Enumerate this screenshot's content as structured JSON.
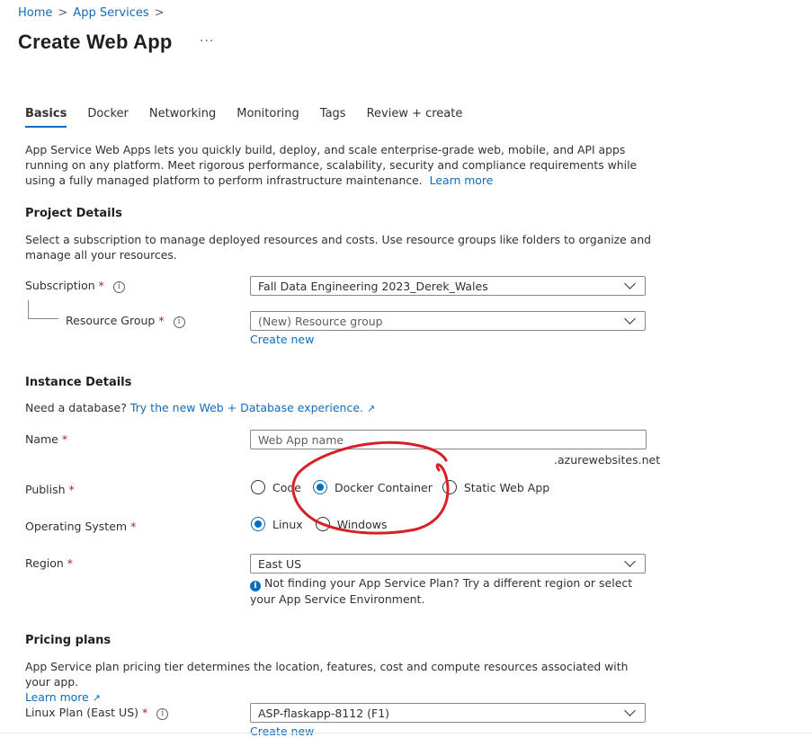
{
  "breadcrumb": {
    "home": "Home",
    "app_services": "App Services",
    "sep": ">"
  },
  "page": {
    "title": "Create Web App",
    "more": "···"
  },
  "tabs": [
    {
      "label": "Basics",
      "active": true
    },
    {
      "label": "Docker"
    },
    {
      "label": "Networking"
    },
    {
      "label": "Monitoring"
    },
    {
      "label": "Tags"
    },
    {
      "label": "Review + create"
    }
  ],
  "intro": {
    "text": "App Service Web Apps lets you quickly build, deploy, and scale enterprise-grade web, mobile, and API apps running on any platform. Meet rigorous performance, scalability, security and compliance requirements while using a fully managed platform to perform infrastructure maintenance.",
    "learn_more": "Learn more"
  },
  "project": {
    "heading": "Project Details",
    "desc": "Select a subscription to manage deployed resources and costs. Use resource groups like folders to organize and manage all your resources.",
    "subscription_label": "Subscription",
    "subscription_value": "Fall Data Engineering 2023_Derek_Wales",
    "resource_group_label": "Resource Group",
    "resource_group_value": "(New) Resource group",
    "create_new": "Create new"
  },
  "instance": {
    "heading": "Instance Details",
    "db_prompt": "Need a database?",
    "db_link": "Try the new Web + Database experience.",
    "name_label": "Name",
    "name_placeholder": "Web App name",
    "domain_suffix": ".azurewebsites.net",
    "publish_label": "Publish",
    "publish_options": [
      "Code",
      "Docker Container",
      "Static Web App"
    ],
    "publish_selected": "Docker Container",
    "os_label": "Operating System",
    "os_options": [
      "Linux",
      "Windows"
    ],
    "os_selected": "Linux",
    "region_label": "Region",
    "region_value": "East US",
    "region_notice": "Not finding your App Service Plan? Try a different region or select your App Service Environment."
  },
  "pricing": {
    "heading": "Pricing plans",
    "desc": "App Service plan pricing tier determines the location, features, cost and compute resources associated with your app.",
    "learn_more": "Learn more",
    "plan_label": "Linux Plan (East US)",
    "plan_value": "ASP-flaskapp-8112 (F1)",
    "create_new": "Create new"
  },
  "required_marker": "*",
  "info_glyph": "i",
  "colors": {
    "accent": "#0f6cbd",
    "required": "#a4262c",
    "annotation": "#d91f26"
  }
}
